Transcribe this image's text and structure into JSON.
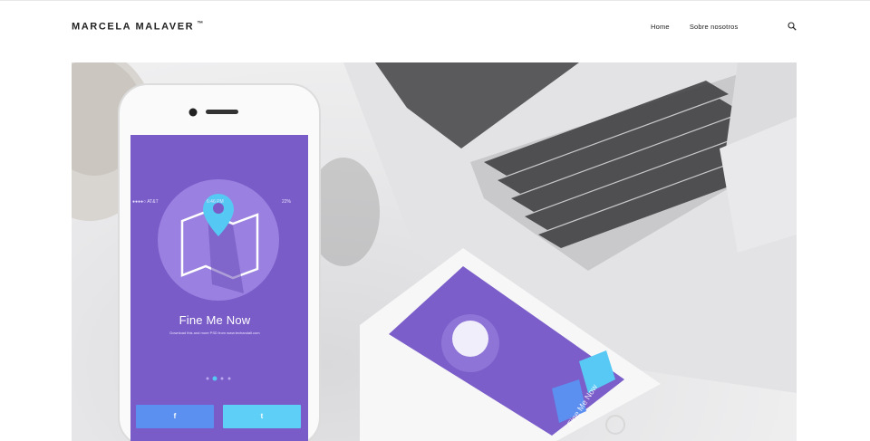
{
  "header": {
    "site_title": "MARCELA MALAVER",
    "trademark": "™",
    "nav": [
      {
        "label": "Home"
      },
      {
        "label": "Sobre nosotros"
      }
    ],
    "search_icon": "search-icon"
  },
  "hero": {
    "phone_front": {
      "carrier": "●●●●○ AT&T",
      "time": "6:46 PM",
      "battery": "22%",
      "app_title": "Fine Me Now",
      "app_subtitle": "Download this and more PSD from www.techandall.com",
      "facebook_label": "f",
      "twitter_label": "t"
    },
    "phone_back": {
      "app_title": "Fine Me Now"
    },
    "colors": {
      "app_purple": "#7a5cc8",
      "facebook_blue": "#5b8ff0",
      "twitter_cyan": "#5ecff6",
      "pin_cyan": "#55c9f3"
    }
  }
}
